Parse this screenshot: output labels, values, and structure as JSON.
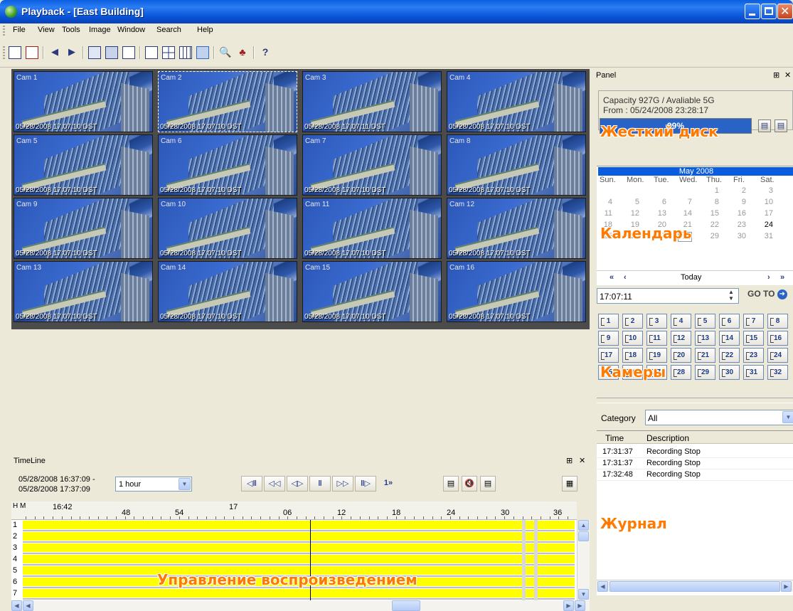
{
  "window": {
    "title": "Playback - [East Building]"
  },
  "menu": [
    "File",
    "View",
    "Tools",
    "Image",
    "Window",
    "Search",
    "Help"
  ],
  "cameras": [
    {
      "label": "Cam 1",
      "ts": "05/28/2008 17:07:10 DST"
    },
    {
      "label": "Cam 2",
      "ts": "05/28/2008 17:07:10 DST"
    },
    {
      "label": "Cam 3",
      "ts": "05/28/2008 17:07:11 DST"
    },
    {
      "label": "Cam 4",
      "ts": "05/28/2008 17:07:10 DST"
    },
    {
      "label": "Cam 5",
      "ts": "05/28/2008 17:07:10 DST"
    },
    {
      "label": "Cam 6",
      "ts": "05/28/2008 17:07:10 DST"
    },
    {
      "label": "Cam 7",
      "ts": "05/28/2008 17:07:10 DST"
    },
    {
      "label": "Cam 8",
      "ts": "05/28/2008 17:07:10 DST"
    },
    {
      "label": "Cam 9",
      "ts": "05/28/2008 17:07:10 DST"
    },
    {
      "label": "Cam 10",
      "ts": "05/28/2008 17:07:10 DST"
    },
    {
      "label": "Cam 11",
      "ts": "05/28/2008 17:07:10 DST"
    },
    {
      "label": "Cam 12",
      "ts": "05/28/2008 17:07:10 DST"
    },
    {
      "label": "Cam 13",
      "ts": "05/28/2008 17:07:10 DST"
    },
    {
      "label": "Cam 14",
      "ts": "05/28/2008 17:07:10 DST"
    },
    {
      "label": "Cam 15",
      "ts": "05/28/2008 17:07:10 DST"
    },
    {
      "label": "Cam 16",
      "ts": "05/28/2008 17:07:10 DST"
    }
  ],
  "timeline": {
    "title": "TimeLine",
    "range_line1": "05/28/2008 16:37:09 -",
    "range_line2": "05/28/2008 17:37:09",
    "interval": "1 hour",
    "ruler_label": "H M",
    "ruler_ticks": [
      "16:42",
      "48",
      "54",
      "17",
      "06",
      "12",
      "18",
      "24",
      "30",
      "36"
    ],
    "tracks": [
      "1",
      "2",
      "3",
      "4",
      "5",
      "6",
      "7"
    ],
    "overlay": "Управление воспроизведением"
  },
  "panel": {
    "title": "Panel",
    "capacity": "Capacity 927G / Avaliable 5G",
    "from": "From  : 05/24/2008 23:28:17",
    "disk_percent": "99%",
    "disk_fill": 0.99,
    "overlay_disk": "Жесткий диск",
    "calendar": {
      "month": "May 2008",
      "dow": [
        "Sun.",
        "Mon.",
        "Tue.",
        "Wed.",
        "Thu.",
        "Fri.",
        "Sat."
      ],
      "overlay": "Календарь",
      "today_label": "Today"
    },
    "time": "17:07:11",
    "goto": "GO TO",
    "cam_buttons": [
      "1",
      "2",
      "3",
      "4",
      "5",
      "6",
      "7",
      "8",
      "9",
      "10",
      "11",
      "12",
      "13",
      "14",
      "15",
      "16",
      "17",
      "18",
      "19",
      "20",
      "21",
      "22",
      "23",
      "24",
      "25",
      "26",
      "27",
      "28",
      "29",
      "30",
      "31",
      "32"
    ],
    "overlay_cams": "Камеры",
    "category_label": "Category",
    "category_value": "All",
    "log_headers": [
      "Time",
      "Description"
    ],
    "log_rows": [
      {
        "time": "17:31:37",
        "desc": "Recording Stop"
      },
      {
        "time": "17:31:37",
        "desc": "Recording Stop"
      },
      {
        "time": "17:32:48",
        "desc": "Recording Stop"
      }
    ],
    "overlay_log": "Журнал"
  },
  "colors": {
    "title_bar": "#0a5ddf",
    "track_fill": "#ffff00",
    "overlay": "#ff7a00",
    "disk_bar": "#2a63c6"
  }
}
